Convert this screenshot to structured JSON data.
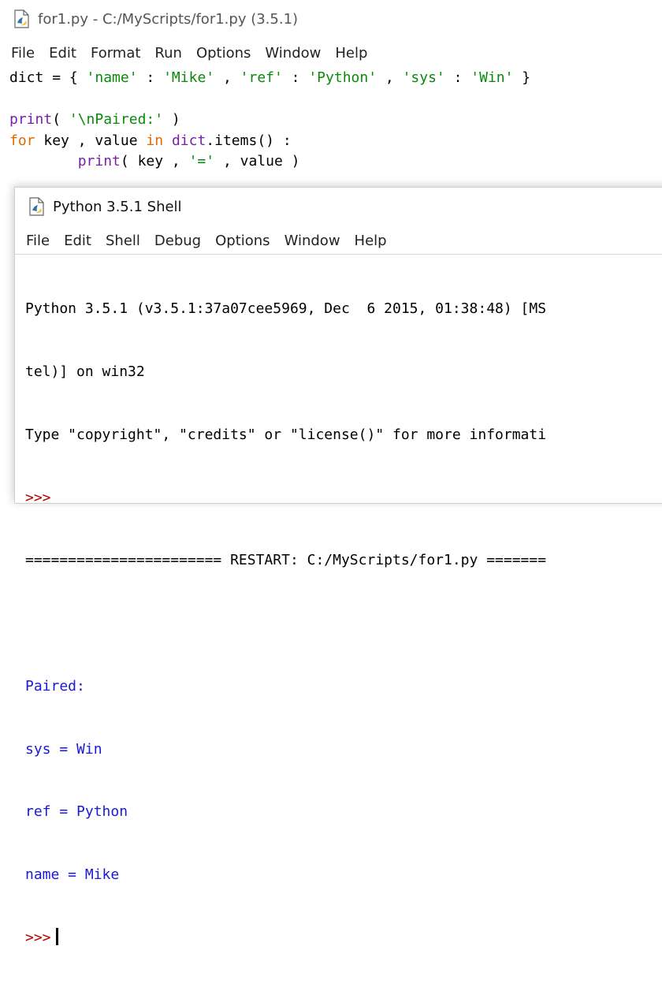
{
  "editor": {
    "title": "for1.py - C:/MyScripts/for1.py (3.5.1)",
    "menu": [
      "File",
      "Edit",
      "Format",
      "Run",
      "Options",
      "Window",
      "Help"
    ],
    "code": {
      "line1": {
        "dict_name": "dict",
        "assign": " = { ",
        "k1": "'name'",
        "c1": " : ",
        "v1": "'Mike'",
        "s1": " , ",
        "k2": "'ref'",
        "c2": " : ",
        "v2": "'Python'",
        "s2": " , ",
        "k3": "'sys'",
        "c3": " : ",
        "v3": "'Win'",
        "close": " }"
      },
      "line3": {
        "fn": "print",
        "open": "( ",
        "arg": "'\\nPaired:'",
        "close": " )"
      },
      "line4": {
        "kw_for": "for",
        "mid1": " key , value ",
        "kw_in": "in",
        "sp": " ",
        "obj": "dict",
        "rest": ".items() :"
      },
      "line5": {
        "indent": "        ",
        "fn": "print",
        "open": "( key , ",
        "arg": "'='",
        "close": " , value )"
      }
    }
  },
  "shell": {
    "title": "Python 3.5.1 Shell",
    "menu": [
      "File",
      "Edit",
      "Shell",
      "Debug",
      "Options",
      "Window",
      "Help"
    ],
    "lines": {
      "banner1": "Python 3.5.1 (v3.5.1:37a07cee5969, Dec  6 2015, 01:38:48) [MS",
      "banner2": "tel)] on win32",
      "banner3": "Type \"copyright\", \"credits\" or \"license()\" for more informati",
      "prompt1": ">>>",
      "restart": "======================= RESTART: C:/MyScripts/for1.py =======",
      "out1": "Paired:",
      "out2": "sys = Win",
      "out3": "ref = Python",
      "out4": "name = Mike",
      "prompt2": ">>>"
    }
  }
}
